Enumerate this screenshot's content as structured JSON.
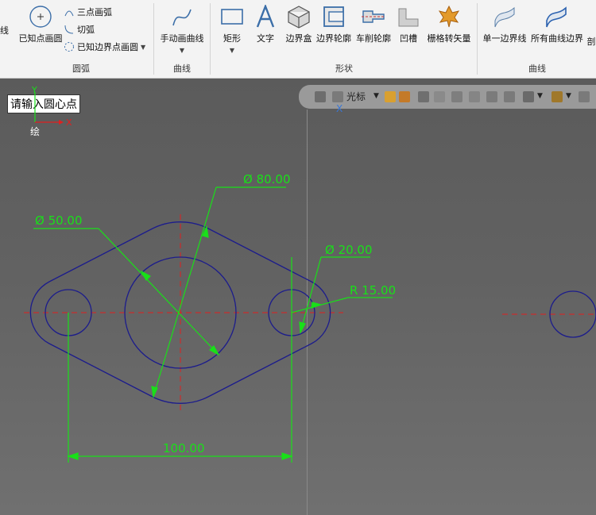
{
  "ribbon": {
    "circle_group": {
      "label": "圆弧",
      "known_point_circle": "已知点画圆",
      "three_point_arc": "三点画弧",
      "tangent_arc": "切弧",
      "boundary_point_circle": "已知边界点画圆"
    },
    "curve_group": {
      "label": "曲线",
      "hand_draw": "手动画曲线"
    },
    "shape_group": {
      "label": "形状",
      "rect": "矩形",
      "text": "文字",
      "boundary_box": "边界盒",
      "boundary_contour": "边界轮廓",
      "lathe_contour": "车削轮廓",
      "groove": "凹槽",
      "grid_vector": "栅格转矢量"
    },
    "curve_group2": {
      "label": "曲线",
      "single_boundary": "单一边界线",
      "all_boundary": "所有曲线边界",
      "cut_partial": "剖"
    },
    "left_partial": "线"
  },
  "canvas": {
    "prompt": "请输入圆心点",
    "axis_y": "Y",
    "axis_x": "X",
    "origin_label": "绘",
    "toolbar": {
      "cursor_label": "光标",
      "axis_x": "X"
    },
    "dims": {
      "d80": "Ø 80.00",
      "d50": "Ø 50.00",
      "d20": "Ø 20.00",
      "r15": "R 15.00",
      "len100": "100.00"
    }
  },
  "colors": {
    "shape_stroke": "#1c1c8c",
    "dimension": "#19e019",
    "centerline": "#e02020"
  }
}
